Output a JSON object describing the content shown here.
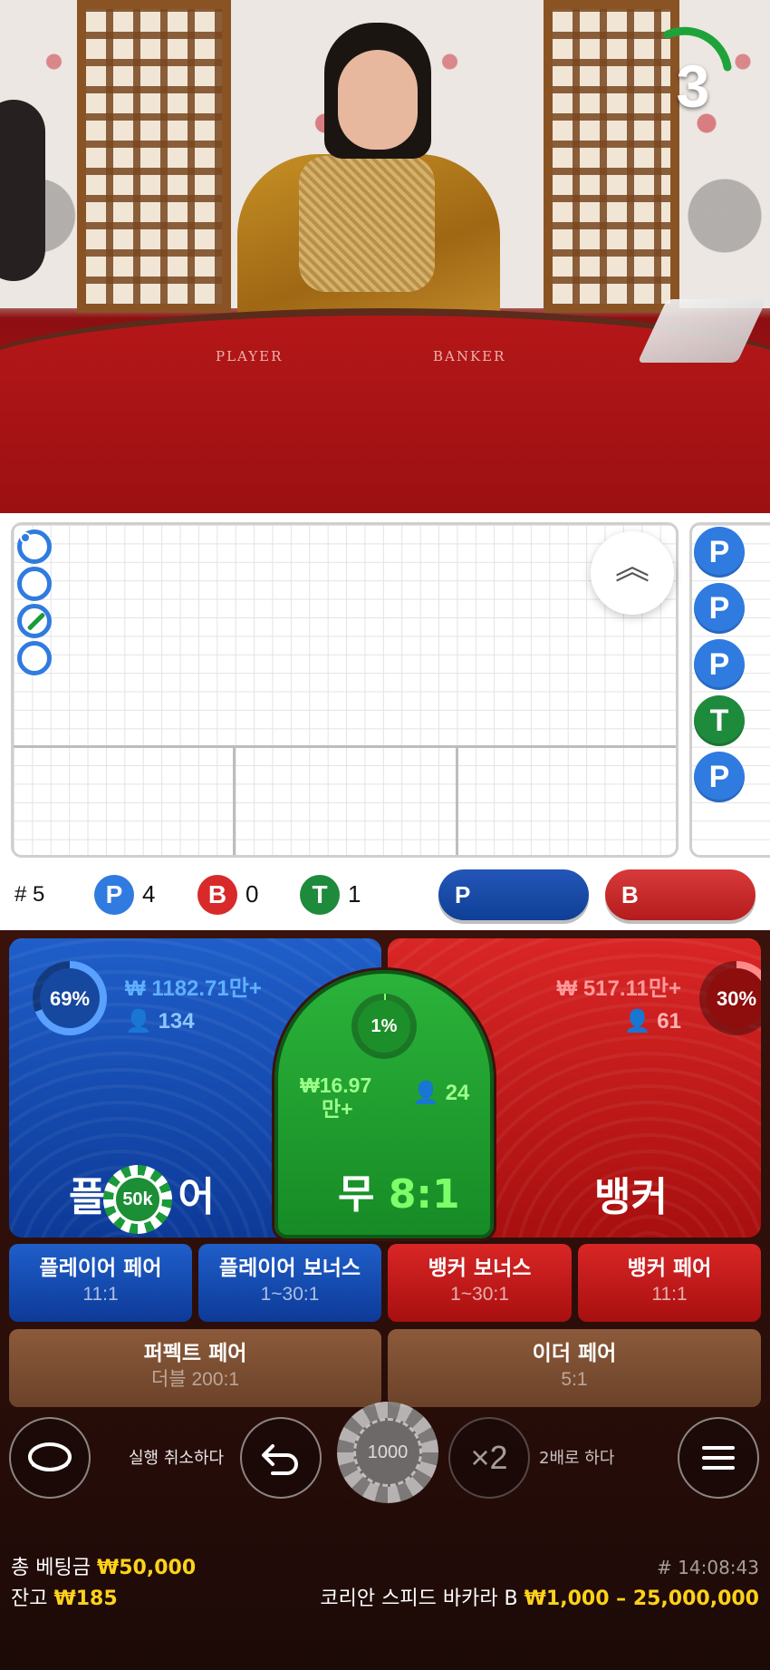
{
  "video": {
    "table_left_label": "PLAYER",
    "table_right_label": "BANKER",
    "countdown": "3"
  },
  "roadmap": {
    "side_beads": [
      "P",
      "P",
      "P",
      "T",
      "P"
    ],
    "collapse_icon": "chevron-double-up-icon"
  },
  "stats": {
    "round_label": "# 5",
    "player_letter": "P",
    "player_count": "4",
    "banker_letter": "B",
    "banker_count": "0",
    "tie_letter": "T",
    "tie_count": "1",
    "player_predict": "P",
    "banker_predict": "B"
  },
  "zones": {
    "player": {
      "pct": "69%",
      "pct_value": 69,
      "amount": "₩ 1182.71만+",
      "players": "134",
      "title_a": "플",
      "title_b": "어"
    },
    "tie": {
      "pct": "1%",
      "pct_value": 1,
      "amount_a": "₩16.97",
      "amount_b": "만+",
      "players": "24",
      "title": "무",
      "odds": "8:1"
    },
    "banker": {
      "pct": "30%",
      "pct_value": 30,
      "amount": "₩ 517.11만+",
      "players": "61",
      "title": "뱅커"
    },
    "placed_chip": "50k"
  },
  "side_bets": [
    {
      "name": "플레이어 페어",
      "odds": "11:1"
    },
    {
      "name": "플레이어 보너스",
      "odds": "1~30:1"
    },
    {
      "name": "뱅커 보너스",
      "odds": "1~30:1"
    },
    {
      "name": "뱅커 페어",
      "odds": "11:1"
    },
    {
      "name": "퍼펙트 페어",
      "odds": "더블 200:1"
    },
    {
      "name": "이더 페어",
      "odds": "5:1"
    }
  ],
  "controls": {
    "undo_label": "실행 취소하다",
    "chip_value": "1000",
    "double_symbol": "×2",
    "double_label": "2배로 하다"
  },
  "footer": {
    "total_bet_label": "총 베팅금",
    "total_bet_value": "₩50,000",
    "balance_label": "잔고",
    "balance_value": "₩185",
    "round_time": "# 14:08:43",
    "table_name": "코리안 스피드 바카라 B",
    "limits": "₩1,000 – 25,000,000"
  },
  "colors": {
    "player_blue": "#1f5ec9",
    "banker_red": "#d92626",
    "tie_green": "#2bb33a",
    "highlight_yellow": "#ffd21a"
  }
}
